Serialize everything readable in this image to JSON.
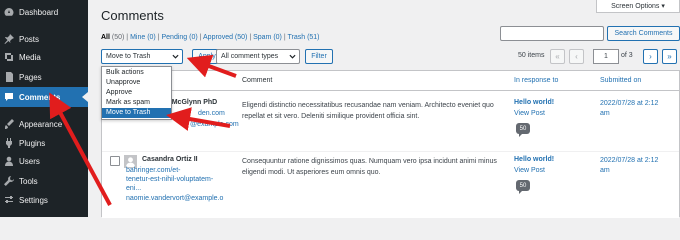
{
  "sidebar": {
    "items": [
      {
        "label": "Dashboard",
        "icon": "dashboard-icon"
      },
      {
        "label": "Posts",
        "icon": "pin-icon"
      },
      {
        "label": "Media",
        "icon": "media-icon"
      },
      {
        "label": "Pages",
        "icon": "pages-icon"
      },
      {
        "label": "Comments",
        "icon": "comment-icon",
        "active": true
      },
      {
        "label": "Appearance",
        "icon": "brush-icon"
      },
      {
        "label": "Plugins",
        "icon": "plugin-icon"
      },
      {
        "label": "Users",
        "icon": "users-icon"
      },
      {
        "label": "Tools",
        "icon": "wrench-icon"
      },
      {
        "label": "Settings",
        "icon": "settings-icon"
      }
    ]
  },
  "header": {
    "title": "Comments",
    "screen_options": "Screen Options ▾"
  },
  "filters": {
    "all": "All",
    "all_count": "(50)",
    "mine": "Mine (0)",
    "pending": "Pending (0)",
    "approved": "Approved (50)",
    "spam": "Spam (0)",
    "trash": "Trash (51)"
  },
  "search": {
    "placeholder": "",
    "button": "Search Comments"
  },
  "toolbar": {
    "bulk_selected": "Move to Trash",
    "apply": "Apply",
    "type_selected": "All comment types",
    "filter": "Filter",
    "items_count": "50 items",
    "current_page": "1",
    "of_pages": "of 3",
    "first": "«",
    "prev": "‹",
    "next": "›",
    "last": "»"
  },
  "bulk_options": [
    "Bulk actions",
    "Unapprove",
    "Approve",
    "Mark as spam",
    "Move to Trash"
  ],
  "table": {
    "headers": {
      "comment": "Comment",
      "in_response_to": "In response to",
      "submitted_on": "Submitted on"
    },
    "rows": [
      {
        "author_name": "ae McGlynn PhD",
        "author_link1": "den.com",
        "author_link2": "@example.com",
        "comment": "Eligendi distinctio necessitatibus recusandae nam veniam. Architecto eveniet quo repellat et sit vero. Deleniti similique provident officia sint.",
        "response_title": "Hello world!",
        "response_view": "View Post",
        "response_count": "50",
        "date_line1": "2022/07/28 at 2:12",
        "date_line2": "am"
      },
      {
        "author_name": "Casandra Ortiz II",
        "author_link1": "bahringer.com/et-",
        "author_link2": "tenetur-est-nihil-voluptatem-",
        "author_link3": "eni...",
        "author_email": "naomie.vandervort@example.o",
        "comment": "Consequuntur ratione dignissimos quas. Numquam vero ipsa incidunt animi minus eligendi modi. Ut asperiores eum omnis quo.",
        "response_title": "Hello world!",
        "response_view": "View Post",
        "response_count": "50",
        "date_line1": "2022/07/28 at 2:12",
        "date_line2": "am"
      }
    ]
  },
  "colors": {
    "sidebar_bg": "#1d2327",
    "accent": "#2271b1",
    "annotation_arrow": "#e11d1d"
  }
}
